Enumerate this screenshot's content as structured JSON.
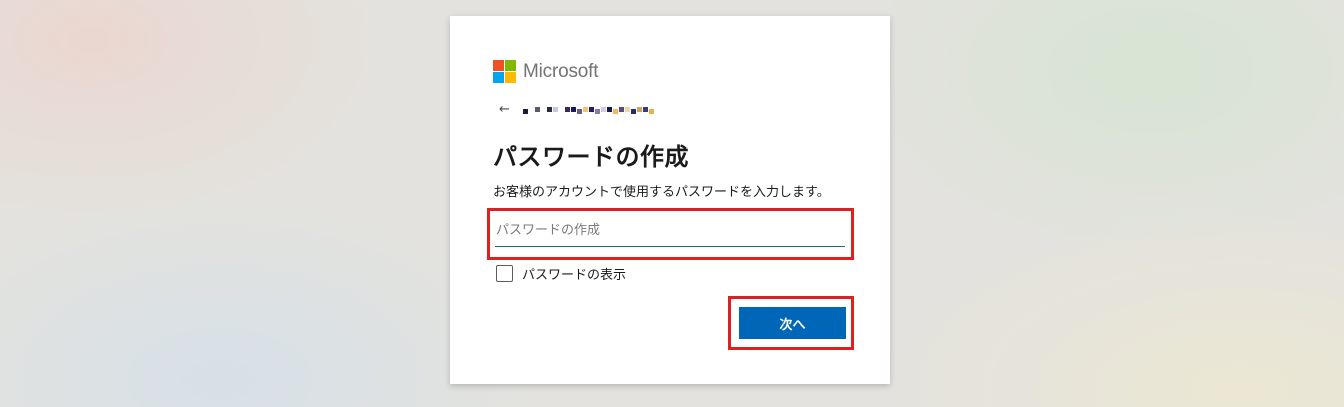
{
  "brand": {
    "name": "Microsoft",
    "logo_colors": [
      "#f25022",
      "#7fba00",
      "#00a4ef",
      "#ffb900"
    ]
  },
  "back": {
    "icon": "back-arrow-icon",
    "glyph": "←"
  },
  "account": {
    "email_obscured": true,
    "pixel_colors": [
      "#1a1a3a",
      "#ffffff",
      "#5a5a6a",
      "#ffffff",
      "#2a2a4a",
      "#c8c8d8",
      "#ffffff",
      "#3a2a5a",
      "#1a1a5a",
      "#6a5a8a",
      "#e8c870",
      "#2a1a5a",
      "#8a7aaa",
      "#d8c8e8",
      "#1a1a4a",
      "#f0b860",
      "#5a4a7a",
      "#e8d8a8",
      "#2a2a6a",
      "#c8a860",
      "#3a3a7a",
      "#e8b050"
    ]
  },
  "title": "パスワードの作成",
  "description": "お客様のアカウントで使用するパスワードを入力します。",
  "password_field": {
    "placeholder": "パスワードの作成",
    "value": ""
  },
  "show_password": {
    "label": "パスワードの表示",
    "checked": false
  },
  "next_button": {
    "label": "次へ"
  },
  "colors": {
    "primary_button": "#0067b8",
    "highlight": "#e31d24",
    "input_underline": "#1b6b73"
  }
}
